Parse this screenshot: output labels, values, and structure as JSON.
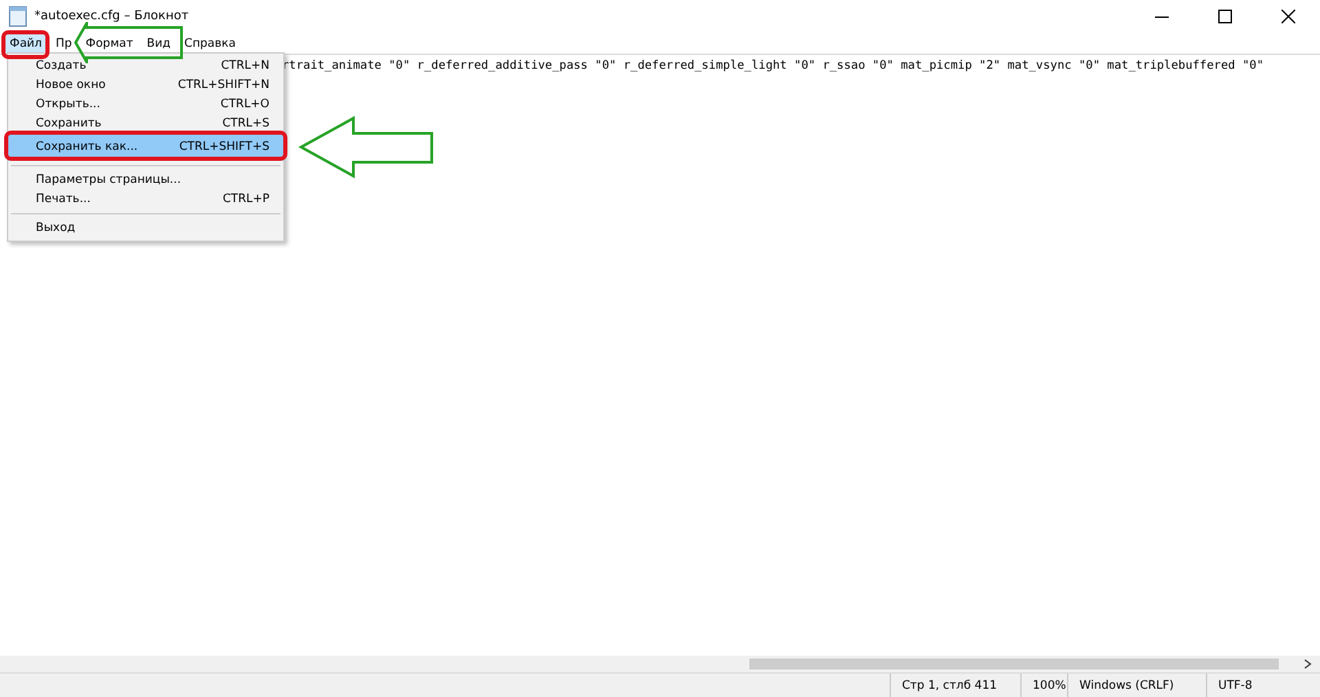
{
  "window": {
    "title": "*autoexec.cfg – Блокнот"
  },
  "menu_bar": [
    {
      "label": "Файл",
      "selected": true
    },
    {
      "label": "Пр",
      "selected": false
    },
    {
      "label": "Формат",
      "selected": false
    },
    {
      "label": "Вид",
      "selected": false
    },
    {
      "label": "Справка",
      "selected": false
    }
  ],
  "file_menu": [
    {
      "kind": "item",
      "label": "Создать",
      "shortcut": "CTRL+N",
      "selected": false
    },
    {
      "kind": "item",
      "label": "Новое окно",
      "shortcut": "CTRL+SHIFT+N",
      "selected": false
    },
    {
      "kind": "item",
      "label": "Открыть...",
      "shortcut": "CTRL+O",
      "selected": false
    },
    {
      "kind": "item",
      "label": "Сохранить",
      "shortcut": "CTRL+S",
      "selected": false
    },
    {
      "kind": "item",
      "label": "Сохранить как...",
      "shortcut": "CTRL+SHIFT+S",
      "selected": true
    },
    {
      "kind": "separator"
    },
    {
      "kind": "item",
      "label": "Параметры страницы...",
      "selected": false
    },
    {
      "kind": "item",
      "label": "Печать...",
      "shortcut": "CTRL+P",
      "selected": false
    },
    {
      "kind": "separator"
    },
    {
      "kind": "item",
      "label": "Выход",
      "selected": false
    }
  ],
  "editor": {
    "line": "rtrait_animate \"0\" r_deferred_additive_pass \"0\" r_deferred_simple_light \"0\" r_ssao \"0\" mat_picmip \"2\" mat_vsync \"0\" mat_triplebuffered \"0\""
  },
  "status_bar": [
    "Стр 1, стлб 411",
    "100%",
    "Windows (CRLF)",
    "UTF-8"
  ]
}
